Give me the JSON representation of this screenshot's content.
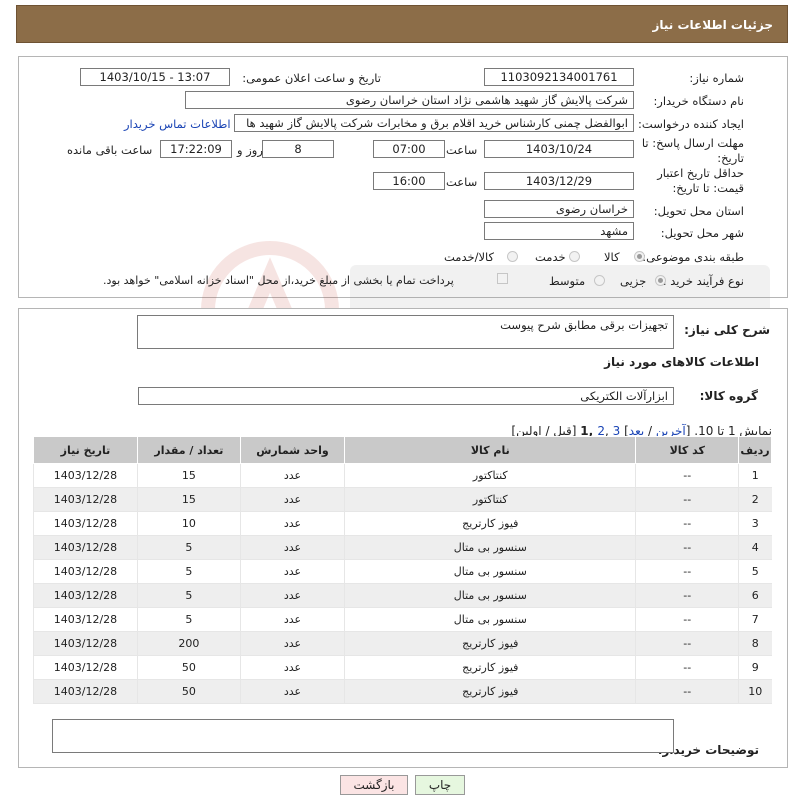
{
  "header": {
    "title": "جزئیات اطلاعات نیاز"
  },
  "form": {
    "need_number_label": "شماره نیاز:",
    "need_number": "1103092134001761",
    "announce_label": "تاریخ و ساعت اعلان عمومی:",
    "announce_value": "1403/10/15 - 13:07",
    "buyer_org_label": "نام دستگاه خریدار:",
    "buyer_org": "شرکت پالایش گاز شهید هاشمی نژاد   استان خراسان رضوی",
    "creator_label": "ایجاد کننده درخواست:",
    "creator": "ابوالفضل چمنی کارشناس خرید اقلام برق و مخابرات شرکت پالایش گاز شهید ها",
    "contact_link": "اطلاعات تماس خریدار",
    "reply_deadline_label": "مهلت ارسال پاسخ: تا تاریخ:",
    "reply_date": "1403/10/24",
    "hour_label": "ساعت",
    "reply_time": "07:00",
    "days_value": "8",
    "day_and_label": "روز و",
    "remaining_time": "17:22:09",
    "remaining_label": "ساعت باقی مانده",
    "price_deadline_label": "حداقل تاریخ اعتبار قیمت: تا تاریخ:",
    "price_date": "1403/12/29",
    "price_hour_label": "ساعت",
    "price_time": "16:00",
    "province_label": "استان محل تحویل:",
    "province": "خراسان رضوی",
    "city_label": "شهر محل تحویل:",
    "city": "مشهد",
    "category_label": "طبقه بندی موضوعی:",
    "category_options": [
      "کالا",
      "خدمت",
      "کالا/خدمت"
    ],
    "purchase_type_label": "نوع فرآیند خرید :",
    "purchase_options": [
      "جزیی",
      "متوسط"
    ],
    "payment_note": "پرداخت تمام یا بخشی از مبلغ خرید،از محل \"اسناد خزانه اسلامی\" خواهد بود."
  },
  "desc": {
    "summary_label": "شرح کلی نیاز:",
    "summary": "تجهیزات برقی مطابق شرح پیوست",
    "goods_info_title": "اطلاعات کالاهای مورد نیاز",
    "goods_group_label": "گروه کالا:",
    "goods_group": "ابزارآلات الکتریکی"
  },
  "pagination": {
    "prefix": "نمایش 1 تا 10. [",
    "last": "آخرین",
    "sep1": " / ",
    "next": "بعد",
    "pages_pre": "] ",
    "page3": "3",
    "comma": " ,",
    "page2": "2",
    "page1": " ,1",
    "suffix": " [قبل / اولین]"
  },
  "table": {
    "headers": [
      "ردیف",
      "کد کالا",
      "نام کالا",
      "واحد شمارش",
      "تعداد / مقدار",
      "تاریخ نیاز"
    ],
    "rows": [
      [
        "1",
        "--",
        "کنتاکتور",
        "عدد",
        "15",
        "1403/12/28"
      ],
      [
        "2",
        "--",
        "کنتاکتور",
        "عدد",
        "15",
        "1403/12/28"
      ],
      [
        "3",
        "--",
        "فیوز کارتریج",
        "عدد",
        "10",
        "1403/12/28"
      ],
      [
        "4",
        "--",
        "سنسور بی متال",
        "عدد",
        "5",
        "1403/12/28"
      ],
      [
        "5",
        "--",
        "سنسور بی متال",
        "عدد",
        "5",
        "1403/12/28"
      ],
      [
        "6",
        "--",
        "سنسور بی متال",
        "عدد",
        "5",
        "1403/12/28"
      ],
      [
        "7",
        "--",
        "سنسور بی متال",
        "عدد",
        "5",
        "1403/12/28"
      ],
      [
        "8",
        "--",
        "فیوز کارتریج",
        "عدد",
        "200",
        "1403/12/28"
      ],
      [
        "9",
        "--",
        "فیوز کارتریج",
        "عدد",
        "50",
        "1403/12/28"
      ],
      [
        "10",
        "--",
        "فیوز کارتریج",
        "عدد",
        "50",
        "1403/12/28"
      ]
    ]
  },
  "buyer_notes": {
    "label": "توضیحات خریدار:",
    "value": ""
  },
  "buttons": {
    "print": "چاپ",
    "back": "بازگشت"
  },
  "colors": {
    "header_bg": "#8c6d48",
    "link": "#1a44b5",
    "back_btn": "#fbe4e4",
    "print_btn": "#e6f7df"
  }
}
